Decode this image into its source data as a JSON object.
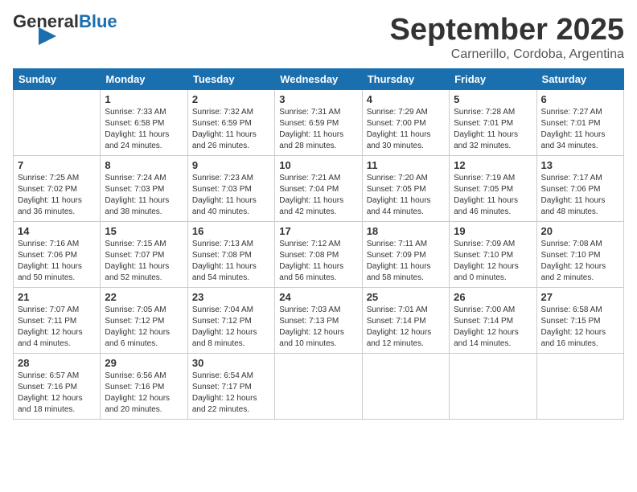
{
  "header": {
    "logo_general": "General",
    "logo_blue": "Blue",
    "month_title": "September 2025",
    "location": "Carnerillo, Cordoba, Argentina"
  },
  "days_of_week": [
    "Sunday",
    "Monday",
    "Tuesday",
    "Wednesday",
    "Thursday",
    "Friday",
    "Saturday"
  ],
  "weeks": [
    [
      {
        "day": "",
        "content": ""
      },
      {
        "day": "1",
        "content": "Sunrise: 7:33 AM\nSunset: 6:58 PM\nDaylight: 11 hours\nand 24 minutes."
      },
      {
        "day": "2",
        "content": "Sunrise: 7:32 AM\nSunset: 6:59 PM\nDaylight: 11 hours\nand 26 minutes."
      },
      {
        "day": "3",
        "content": "Sunrise: 7:31 AM\nSunset: 6:59 PM\nDaylight: 11 hours\nand 28 minutes."
      },
      {
        "day": "4",
        "content": "Sunrise: 7:29 AM\nSunset: 7:00 PM\nDaylight: 11 hours\nand 30 minutes."
      },
      {
        "day": "5",
        "content": "Sunrise: 7:28 AM\nSunset: 7:01 PM\nDaylight: 11 hours\nand 32 minutes."
      },
      {
        "day": "6",
        "content": "Sunrise: 7:27 AM\nSunset: 7:01 PM\nDaylight: 11 hours\nand 34 minutes."
      }
    ],
    [
      {
        "day": "7",
        "content": "Sunrise: 7:25 AM\nSunset: 7:02 PM\nDaylight: 11 hours\nand 36 minutes."
      },
      {
        "day": "8",
        "content": "Sunrise: 7:24 AM\nSunset: 7:03 PM\nDaylight: 11 hours\nand 38 minutes."
      },
      {
        "day": "9",
        "content": "Sunrise: 7:23 AM\nSunset: 7:03 PM\nDaylight: 11 hours\nand 40 minutes."
      },
      {
        "day": "10",
        "content": "Sunrise: 7:21 AM\nSunset: 7:04 PM\nDaylight: 11 hours\nand 42 minutes."
      },
      {
        "day": "11",
        "content": "Sunrise: 7:20 AM\nSunset: 7:05 PM\nDaylight: 11 hours\nand 44 minutes."
      },
      {
        "day": "12",
        "content": "Sunrise: 7:19 AM\nSunset: 7:05 PM\nDaylight: 11 hours\nand 46 minutes."
      },
      {
        "day": "13",
        "content": "Sunrise: 7:17 AM\nSunset: 7:06 PM\nDaylight: 11 hours\nand 48 minutes."
      }
    ],
    [
      {
        "day": "14",
        "content": "Sunrise: 7:16 AM\nSunset: 7:06 PM\nDaylight: 11 hours\nand 50 minutes."
      },
      {
        "day": "15",
        "content": "Sunrise: 7:15 AM\nSunset: 7:07 PM\nDaylight: 11 hours\nand 52 minutes."
      },
      {
        "day": "16",
        "content": "Sunrise: 7:13 AM\nSunset: 7:08 PM\nDaylight: 11 hours\nand 54 minutes."
      },
      {
        "day": "17",
        "content": "Sunrise: 7:12 AM\nSunset: 7:08 PM\nDaylight: 11 hours\nand 56 minutes."
      },
      {
        "day": "18",
        "content": "Sunrise: 7:11 AM\nSunset: 7:09 PM\nDaylight: 11 hours\nand 58 minutes."
      },
      {
        "day": "19",
        "content": "Sunrise: 7:09 AM\nSunset: 7:10 PM\nDaylight: 12 hours\nand 0 minutes."
      },
      {
        "day": "20",
        "content": "Sunrise: 7:08 AM\nSunset: 7:10 PM\nDaylight: 12 hours\nand 2 minutes."
      }
    ],
    [
      {
        "day": "21",
        "content": "Sunrise: 7:07 AM\nSunset: 7:11 PM\nDaylight: 12 hours\nand 4 minutes."
      },
      {
        "day": "22",
        "content": "Sunrise: 7:05 AM\nSunset: 7:12 PM\nDaylight: 12 hours\nand 6 minutes."
      },
      {
        "day": "23",
        "content": "Sunrise: 7:04 AM\nSunset: 7:12 PM\nDaylight: 12 hours\nand 8 minutes."
      },
      {
        "day": "24",
        "content": "Sunrise: 7:03 AM\nSunset: 7:13 PM\nDaylight: 12 hours\nand 10 minutes."
      },
      {
        "day": "25",
        "content": "Sunrise: 7:01 AM\nSunset: 7:14 PM\nDaylight: 12 hours\nand 12 minutes."
      },
      {
        "day": "26",
        "content": "Sunrise: 7:00 AM\nSunset: 7:14 PM\nDaylight: 12 hours\nand 14 minutes."
      },
      {
        "day": "27",
        "content": "Sunrise: 6:58 AM\nSunset: 7:15 PM\nDaylight: 12 hours\nand 16 minutes."
      }
    ],
    [
      {
        "day": "28",
        "content": "Sunrise: 6:57 AM\nSunset: 7:16 PM\nDaylight: 12 hours\nand 18 minutes."
      },
      {
        "day": "29",
        "content": "Sunrise: 6:56 AM\nSunset: 7:16 PM\nDaylight: 12 hours\nand 20 minutes."
      },
      {
        "day": "30",
        "content": "Sunrise: 6:54 AM\nSunset: 7:17 PM\nDaylight: 12 hours\nand 22 minutes."
      },
      {
        "day": "",
        "content": ""
      },
      {
        "day": "",
        "content": ""
      },
      {
        "day": "",
        "content": ""
      },
      {
        "day": "",
        "content": ""
      }
    ]
  ]
}
